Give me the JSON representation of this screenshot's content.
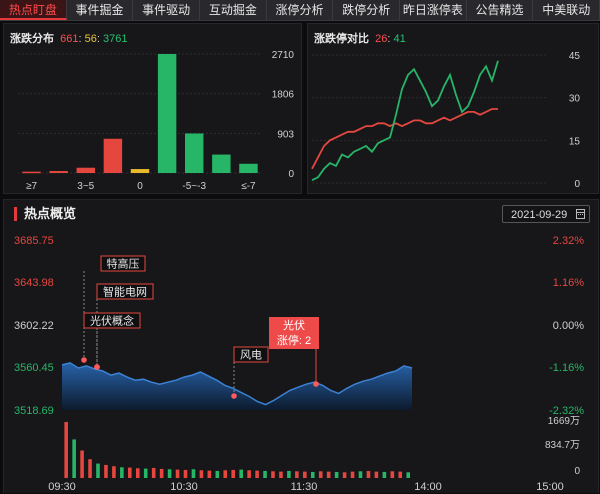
{
  "tabs": [
    {
      "label": "热点盯盘",
      "active": true
    },
    {
      "label": "事件掘金",
      "active": false
    },
    {
      "label": "事件驱动",
      "active": false
    },
    {
      "label": "互动掘金",
      "active": false
    },
    {
      "label": "涨停分析",
      "active": false
    },
    {
      "label": "跌停分析",
      "active": false
    },
    {
      "label": "昨日涨停表现",
      "active": false
    },
    {
      "label": "公告精选",
      "active": false
    },
    {
      "label": "中美联动",
      "active": false
    }
  ],
  "distribution": {
    "title": "涨跌分布",
    "up": "661",
    "flat": "56",
    "down": "3761",
    "sep": ":"
  },
  "ratio": {
    "title": "涨跌停对比",
    "limit_up": "26",
    "limit_down": "41",
    "sep": ":"
  },
  "hot": {
    "title": "热点概览",
    "date": "2021-09-29",
    "calendar_icon": "calendar-icon",
    "price_labels": [
      "3685.75",
      "3643.98",
      "3602.22",
      "3560.45",
      "3518.69"
    ],
    "pct_labels": [
      "2.32%",
      "1.16%",
      "0.00%",
      "-1.16%",
      "-2.32%"
    ],
    "volume_labels": [
      "1669万",
      "834.7万",
      "0"
    ],
    "time_labels": [
      "09:30",
      "10:30",
      "11:30",
      "14:00",
      "15:00"
    ],
    "event_tags": [
      {
        "label": "特高压"
      },
      {
        "label": "智能电网"
      },
      {
        "label": "光伏概念"
      },
      {
        "label": "风电"
      },
      {
        "label": "光伏",
        "sub": "涨停: 2",
        "highlight": true
      }
    ]
  },
  "colors": {
    "up": "#e5473f",
    "down": "#27b567",
    "flat": "#e8b92c",
    "accent": "#e5393b",
    "index_line": "#3b82d6"
  },
  "chart_data": [
    {
      "type": "bar",
      "title": "涨跌分布",
      "categories": [
        "≥7",
        "",
        "3~5",
        "",
        "0",
        "",
        "-5~-3",
        "",
        "≤-7"
      ],
      "tick_labels": [
        "≥7",
        "3~5",
        "0",
        "-5~-3",
        "≤-7"
      ],
      "values": [
        30,
        45,
        120,
        780,
        90,
        2710,
        900,
        420,
        210
      ],
      "colors": [
        "#e5473f",
        "#e5473f",
        "#e5473f",
        "#e5473f",
        "#e8b92c",
        "#27b567",
        "#27b567",
        "#27b567",
        "#27b567"
      ],
      "yticks": [
        "2710",
        "1806",
        "903",
        "0"
      ],
      "ylim": [
        0,
        2710
      ],
      "grid": true
    },
    {
      "type": "line",
      "title": "涨跌停对比",
      "yticks": [
        "45",
        "30",
        "15",
        "0"
      ],
      "ylim": [
        0,
        45
      ],
      "series": [
        {
          "color": "#e5473f",
          "values": [
            5,
            9,
            13,
            15,
            16,
            17,
            18,
            18,
            19,
            20,
            20,
            21,
            21,
            20,
            21,
            20,
            21,
            22,
            22,
            21,
            21,
            22,
            23,
            22,
            23,
            24,
            25,
            25,
            24,
            25,
            26,
            26
          ]
        },
        {
          "color": "#27b567",
          "values": [
            1,
            2,
            5,
            7,
            6,
            10,
            9,
            11,
            12,
            13,
            11,
            14,
            15,
            16,
            24,
            33,
            38,
            40,
            36,
            32,
            27,
            29,
            34,
            38,
            31,
            25,
            27,
            32,
            38,
            41,
            36,
            43
          ]
        }
      ]
    },
    {
      "type": "line",
      "title": "热点概览",
      "ylim": [
        3518.69,
        3685.75
      ],
      "yticks": [
        3685.75,
        3643.98,
        3602.22,
        3560.45,
        3518.69
      ],
      "x": [
        "09:30",
        "10:30",
        "11:30",
        "14:00",
        "15:00"
      ],
      "series": [
        {
          "values": [
            3563,
            3565,
            3560,
            3562,
            3559,
            3557,
            3553,
            3555,
            3551,
            3548,
            3549,
            3546,
            3544,
            3546,
            3548,
            3551,
            3553,
            3556,
            3552,
            3548,
            3543,
            3540,
            3536,
            3532,
            3527,
            3524,
            3528,
            3533,
            3538,
            3541,
            3544,
            3546,
            3543,
            3538,
            3535,
            3540,
            3544,
            3547,
            3549,
            3552,
            3555,
            3557,
            3562,
            3560
          ]
        }
      ],
      "volume": [
        1669,
        1150,
        820,
        560,
        430,
        390,
        350,
        320,
        310,
        290,
        280,
        300,
        270,
        260,
        250,
        240,
        260,
        230,
        220,
        210,
        230,
        240,
        250,
        230,
        220,
        210,
        200,
        190,
        210,
        200,
        190,
        180,
        200,
        190,
        180,
        170,
        190,
        200,
        210,
        190,
        180,
        200,
        190,
        170
      ]
    }
  ]
}
